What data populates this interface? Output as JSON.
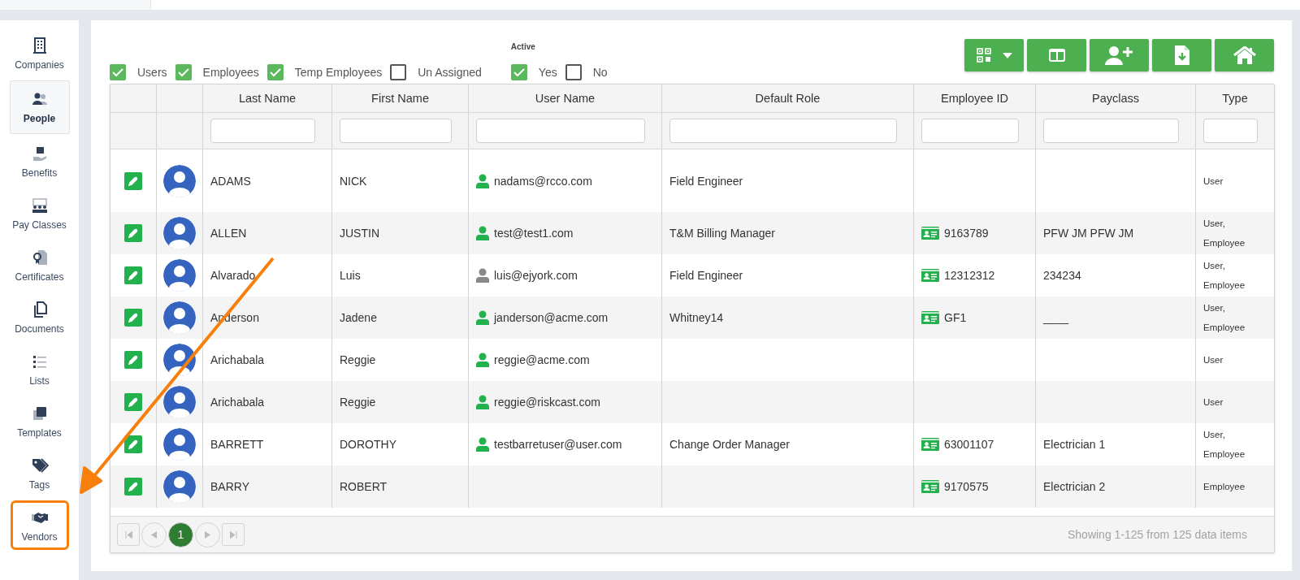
{
  "sidebar": {
    "items": [
      {
        "kind": "building",
        "label": "Companies",
        "selected": false,
        "highlighted": false
      },
      {
        "kind": "people",
        "label": "People",
        "selected": true,
        "highlighted": false
      },
      {
        "kind": "benefits",
        "label": "Benefits",
        "selected": false,
        "highlighted": false
      },
      {
        "kind": "classes",
        "label": "Pay Classes",
        "selected": false,
        "highlighted": false
      },
      {
        "kind": "certificate",
        "label": "Certificates",
        "selected": false,
        "highlighted": false
      },
      {
        "kind": "documents",
        "label": "Documents",
        "selected": false,
        "highlighted": false
      },
      {
        "kind": "lists",
        "label": "Lists",
        "selected": false,
        "highlighted": false
      },
      {
        "kind": "templates",
        "label": "Templates",
        "selected": false,
        "highlighted": false
      },
      {
        "kind": "tags",
        "label": "Tags",
        "selected": false,
        "highlighted": false
      },
      {
        "kind": "handshake",
        "label": "Vendors",
        "selected": false,
        "highlighted": true
      }
    ]
  },
  "filters": [
    {
      "label": "Users",
      "checked": true
    },
    {
      "label": "Employees",
      "checked": true
    },
    {
      "label": "Temp Employees",
      "checked": true
    },
    {
      "label": "Un Assigned",
      "checked": false
    }
  ],
  "active": {
    "label": "Active",
    "options": [
      {
        "label": "Yes",
        "checked": true
      },
      {
        "label": "No",
        "checked": false
      }
    ]
  },
  "toolbar": [
    {
      "kind": "qr-menu"
    },
    {
      "kind": "columns"
    },
    {
      "kind": "add-user"
    },
    {
      "kind": "export"
    },
    {
      "kind": "home"
    }
  ],
  "table": {
    "columns": [
      "Last Name",
      "First Name",
      "User Name",
      "Default Role",
      "Employee ID",
      "Payclass",
      "Type"
    ],
    "rows": [
      {
        "last": "ADAMS",
        "first": "NICK",
        "user": "nadams@rcco.com",
        "user_active": true,
        "role": "Field Engineer",
        "employee_id": "",
        "payclass": "",
        "type": "User"
      },
      {
        "last": "ALLEN",
        "first": "JUSTIN",
        "user": "test@test1.com",
        "user_active": true,
        "role": "T&M Billing Manager",
        "employee_id": "9163789",
        "payclass": "PFW JM PFW JM",
        "type": "User, Employee"
      },
      {
        "last": "Alvarado",
        "first": "Luis",
        "user": "luis@ejyork.com",
        "user_active": false,
        "role": "Field Engineer",
        "employee_id": "12312312",
        "payclass": "234234",
        "type": "User, Employee"
      },
      {
        "last": "Anderson",
        "first": "Jadene",
        "user": "janderson@acme.com",
        "user_active": true,
        "role": "Whitney14",
        "employee_id": "GF1",
        "payclass": "____",
        "type": "User, Employee"
      },
      {
        "last": "Arichabala",
        "first": "Reggie",
        "user": "reggie@acme.com",
        "user_active": true,
        "role": "",
        "employee_id": "",
        "payclass": "",
        "type": "User"
      },
      {
        "last": "Arichabala",
        "first": "Reggie",
        "user": "reggie@riskcast.com",
        "user_active": true,
        "role": "",
        "employee_id": "",
        "payclass": "",
        "type": "User"
      },
      {
        "last": "BARRETT",
        "first": "DOROTHY",
        "user": "testbarretuser@user.com",
        "user_active": true,
        "role": "Change Order Manager",
        "employee_id": "63001107",
        "payclass": "Electrician 1",
        "type": "User, Employee"
      },
      {
        "last": "BARRY",
        "first": "ROBERT",
        "user": "",
        "role": "",
        "employee_id": "9170575",
        "payclass": "Electrician 2",
        "type": "Employee"
      }
    ]
  },
  "pager": {
    "pages": [
      {
        "label": "1",
        "selected": true
      }
    ],
    "summary": "Showing 1-125 from 125 data items"
  }
}
